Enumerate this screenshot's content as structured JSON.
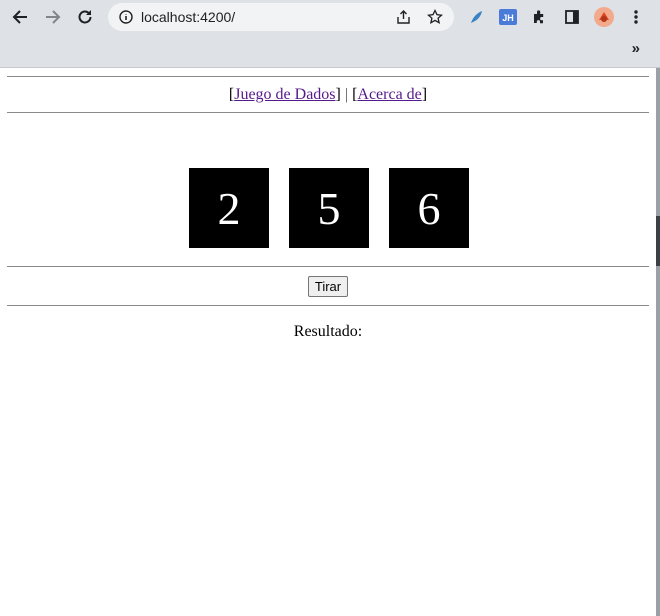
{
  "browser": {
    "url": "localhost:4200/",
    "extensions": [
      "feather-icon",
      "jh-icon",
      "puzzle-icon",
      "sidepanel-icon",
      "avatar-icon"
    ],
    "overflow": "»"
  },
  "nav": {
    "juego_label": "Juego de Dados",
    "acerca_label": "Acerca de",
    "separator": "|",
    "bracket_open": "[",
    "bracket_close": "]"
  },
  "dice": {
    "values": [
      "2",
      "5",
      "6"
    ]
  },
  "button": {
    "label": "Tirar"
  },
  "result": {
    "label": "Resultado:"
  }
}
